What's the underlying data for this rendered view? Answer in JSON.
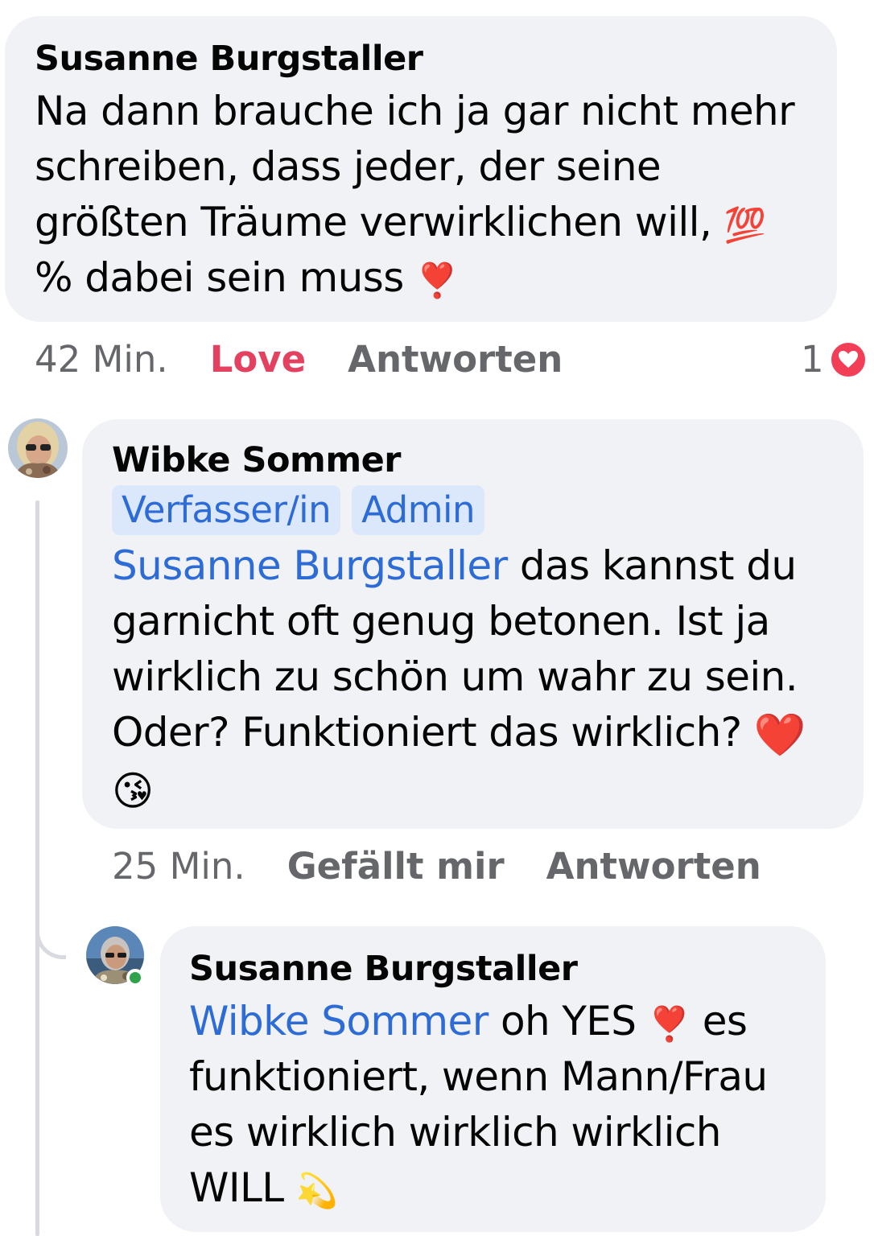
{
  "comment1": {
    "author": "Susanne Burgstaller",
    "text_before_emoji": "Na dann brauche ich ja gar nicht mehr schreiben, dass jeder, der seine größten Träume verwirklichen will, ",
    "emoji_hundred": "💯",
    "text_after_emoji": " % dabei sein muss ",
    "emoji_exclaim": "❣️",
    "time": "42 Min.",
    "reaction_action": "Love",
    "reply_action": "Antworten",
    "reaction_count": "1"
  },
  "comment2": {
    "author": "Wibke Sommer",
    "badges": [
      "Verfasser/in",
      "Admin"
    ],
    "mention": "Susanne Burgstaller",
    "text": " das kannst du garnicht oft genug betonen. Ist ja wirklich zu schön um wahr zu sein. Oder? Funktioniert das wirklich? ",
    "emoji_heart": "❤️",
    "emoji_kiss": "😘",
    "time": "25 Min.",
    "like_action": "Gefällt mir",
    "reply_action": "Antworten"
  },
  "comment3": {
    "author": "Susanne Burgstaller",
    "mention": "Wibke Sommer",
    "text_before_emoji": " oh YES ",
    "emoji_exclaim": "❣️",
    "text_after_emoji": " es funktioniert, wenn  Mann/Frau es wirklich wirklich wirklich WILL ",
    "emoji_dizzy": "💫"
  },
  "colors": {
    "bubble": "#f0f2f5",
    "mention": "#2d6bd6",
    "love": "#e4405f",
    "meta": "#65676b",
    "online": "#31a24c"
  }
}
